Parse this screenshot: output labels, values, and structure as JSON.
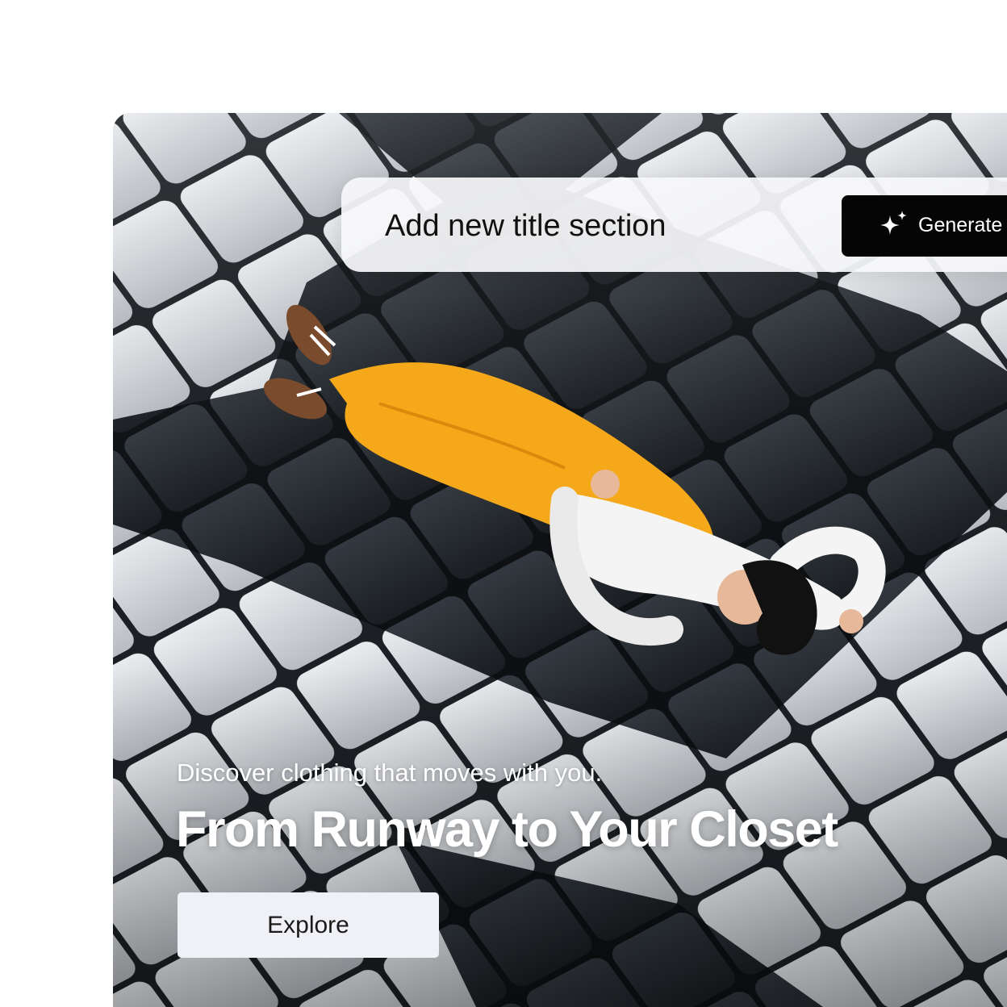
{
  "hero": {
    "image_alt": "Woman in yellow overalls and white shirt lying on a black and white tiled floor",
    "tagline": "Discover clothing that moves with you.",
    "headline": "From Runway to Your Closet",
    "explore_label": "Explore"
  },
  "title_bar": {
    "placeholder": "Add new title section",
    "generate_label": "Generate",
    "generate_icon": "sparkle-icon"
  },
  "colors": {
    "card_text": "#ffffff",
    "generate_button_bg": "#050505",
    "explore_button_bg": "#f0f1f6",
    "title_bar_bg": "#f8f8fa",
    "outfit_yellow": "#f5a91a"
  }
}
